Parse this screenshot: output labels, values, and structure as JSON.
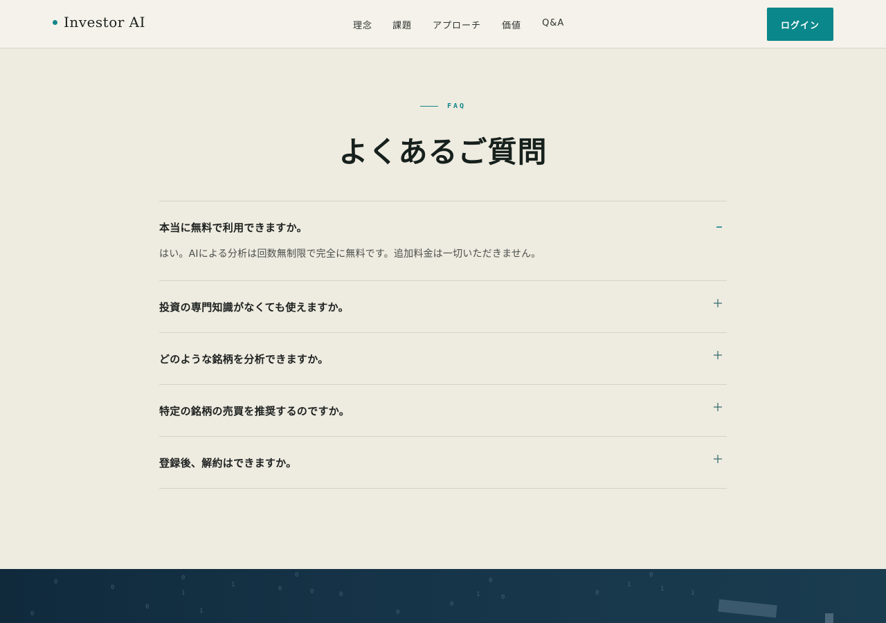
{
  "header": {
    "logo_text": "Investor AI",
    "nav": [
      "理念",
      "課題",
      "アプローチ",
      "価値",
      "Q&A"
    ],
    "login_label": "ログイン"
  },
  "faq_section": {
    "eyebrow": "FAQ",
    "title": "よくあるご質問",
    "items": [
      {
        "question": "本当に無料で利用できますか。",
        "answer": "はい。AIによる分析は回数無制限で完全に無料です。追加料金は一切いただきません。",
        "expanded": true
      },
      {
        "question": "投資の専門知識がなくても使えますか。",
        "expanded": false
      },
      {
        "question": "どのような銘柄を分析できますか。",
        "expanded": false
      },
      {
        "question": "特定の銘柄の売買を推奨するのですか。",
        "expanded": false
      },
      {
        "question": "登録後、解約はできますか。",
        "expanded": false
      }
    ]
  },
  "colors": {
    "accent": "#0a878a",
    "background": "#eeebe0",
    "header_bg": "#f4f2ea",
    "dark_band": "#163448"
  },
  "icons": {
    "expanded": "minus-icon",
    "collapsed": "plus-icon"
  }
}
